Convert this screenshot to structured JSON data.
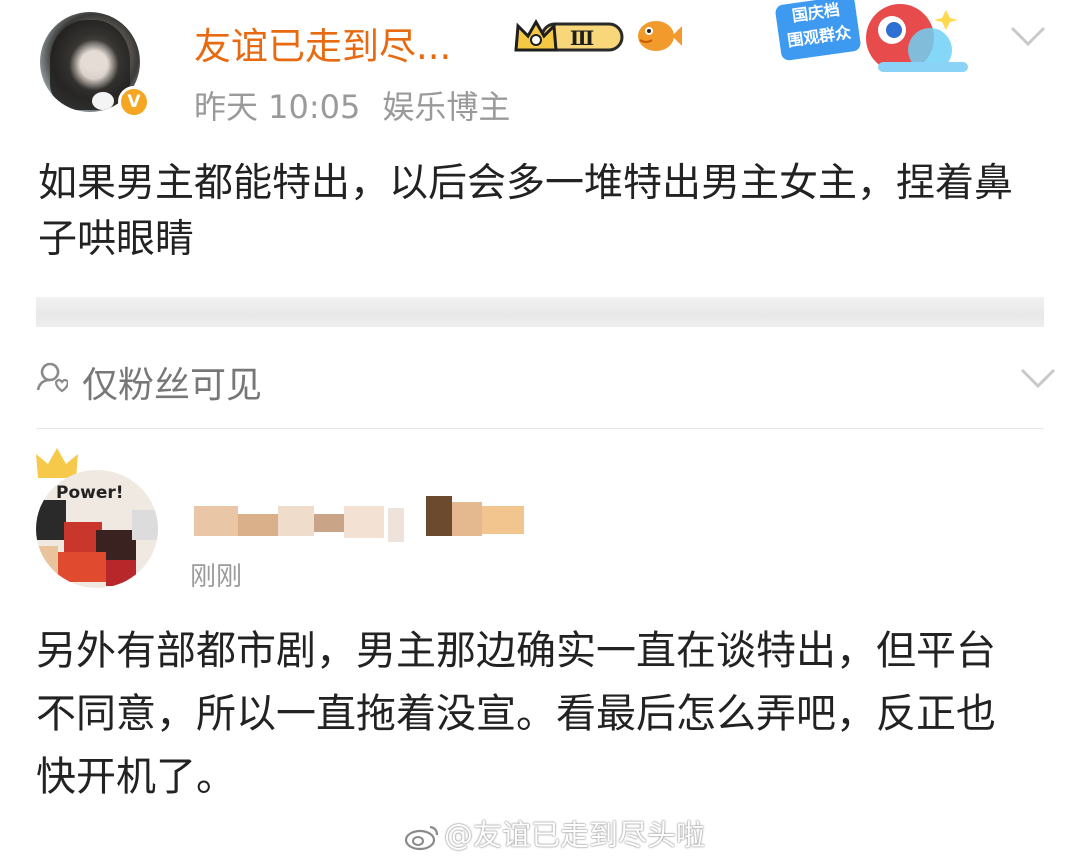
{
  "post": {
    "author_name": "友谊已走到尽...",
    "level_badge": "Ⅲ",
    "verified_mark": "V",
    "timestamp": "昨天 10:05",
    "source": "娱乐博主",
    "text": "如果男主都能特出，以后会多一堆特出男主女主，捏着鼻子哄眼睛",
    "festival_badge_text": [
      "国庆档",
      "围观群众"
    ]
  },
  "visibility": {
    "label": "仅粉丝可见",
    "icon": "fans-only-icon"
  },
  "reply": {
    "avatar_badge": "Power!",
    "timestamp": "刚刚",
    "text": "另外有部都市剧，男主那边确实一直在谈特出，但平台不同意，所以一直拖着没宣。看最后怎么弄吧，反正也快开机了。"
  },
  "watermark": {
    "text": "@友谊已走到尽头啦",
    "icon": "weibo-logo-icon"
  },
  "colors": {
    "username": "#e86a10",
    "meta_text": "#9a9a9a",
    "body_text": "#222222",
    "verified": "#f5a623"
  }
}
